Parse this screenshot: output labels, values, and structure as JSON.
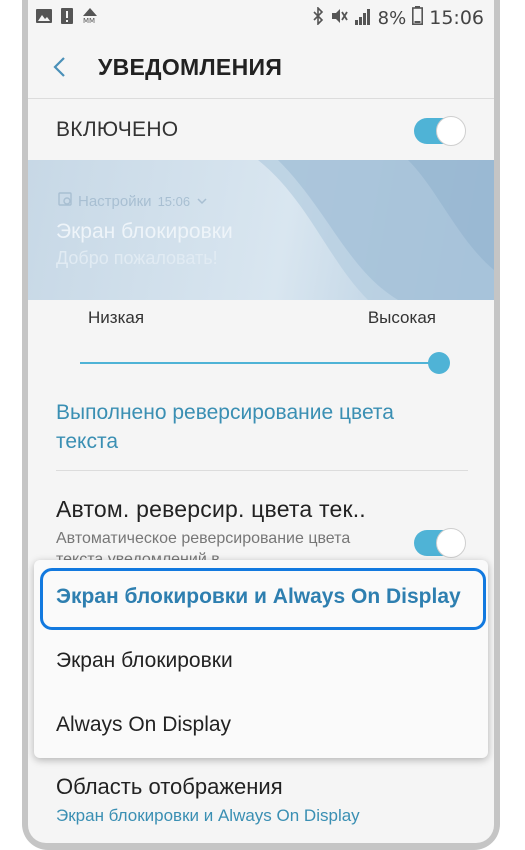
{
  "status_bar": {
    "battery_percent": "8%",
    "time": "15:06",
    "icons": [
      "image-icon",
      "alert-icon",
      "mm-icon",
      "bluetooth-icon",
      "mute-icon",
      "signal-icon",
      "battery-icon"
    ]
  },
  "header": {
    "title": "УВЕДОМЛЕНИЯ",
    "back_icon": "chevron-left-icon"
  },
  "master_toggle": {
    "label": "ВКЛЮЧЕНО",
    "checked": true
  },
  "preview": {
    "app_name": "Настройки",
    "app_time": "15:06",
    "title": "Экран блокировки",
    "subtitle": "Добро пожаловать!"
  },
  "transparency_slider": {
    "low_label": "Низкая",
    "high_label": "Высокая",
    "value": 1.0
  },
  "reversed_text": "Выполнено реверсирование цвета текста",
  "auto_reverse": {
    "title": "Автом. реверсир. цвета тек..",
    "description": "Автоматическое реверсирование цвета текста уведомлений в",
    "checked": true
  },
  "display_options": {
    "options": [
      "Экран блокировки и Always On Display",
      "Экран блокировки",
      "Always On Display"
    ],
    "selected_index": 0
  },
  "display_area": {
    "title": "Область отображения",
    "value": "Экран блокировки и Always On Display"
  },
  "colors": {
    "accent": "#4fb3d6",
    "link_text": "#3a8fb3",
    "highlight_border": "#1279df"
  }
}
